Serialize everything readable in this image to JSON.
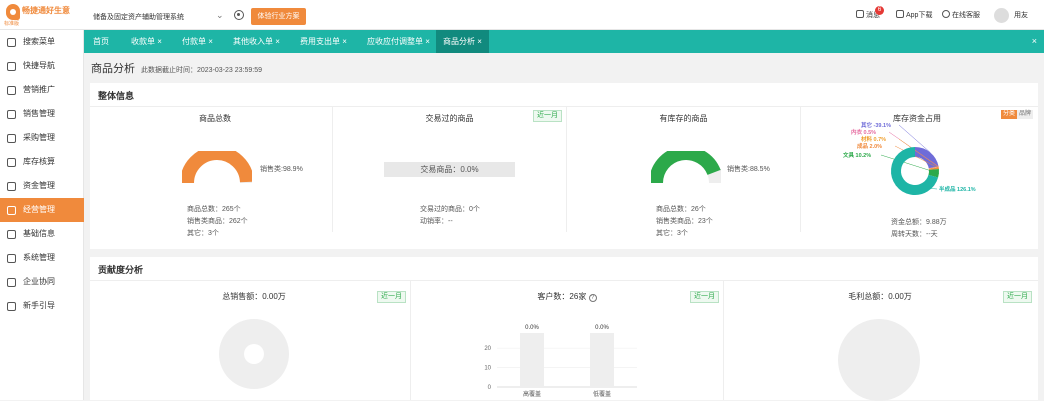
{
  "app": {
    "brand_name": "畅捷通好生意",
    "brand_edition": "标准版",
    "company": "储备及固定资产辅助管理系统",
    "try_button": "体验行业方案"
  },
  "topbar": {
    "message": "消息",
    "message_count": "6",
    "app_download": "App下载",
    "online_service": "在线客服",
    "user": "用友"
  },
  "sidebar": {
    "items": [
      {
        "label": "搜索菜单",
        "icon": "search-icon"
      },
      {
        "label": "快捷导航",
        "icon": "home-icon"
      },
      {
        "label": "营销推广",
        "icon": "calendar-icon"
      },
      {
        "label": "销售管理",
        "icon": "sales-icon"
      },
      {
        "label": "采购管理",
        "icon": "purchase-icon"
      },
      {
        "label": "库存核算",
        "icon": "warehouse-icon"
      },
      {
        "label": "资金管理",
        "icon": "fund-icon"
      },
      {
        "label": "经营管理",
        "icon": "business-icon",
        "active": true
      },
      {
        "label": "基础信息",
        "icon": "info-icon"
      },
      {
        "label": "系统管理",
        "icon": "system-icon"
      },
      {
        "label": "企业协同",
        "icon": "collab-icon"
      },
      {
        "label": "新手引导",
        "icon": "guide-icon"
      }
    ]
  },
  "tabs": [
    {
      "label": "首页",
      "close": ""
    },
    {
      "label": "收款单",
      "close": "×"
    },
    {
      "label": "付款单",
      "close": "×"
    },
    {
      "label": "其他收入单",
      "close": "×"
    },
    {
      "label": "费用支出单",
      "close": "×"
    },
    {
      "label": "应收应付调整单",
      "close": "×"
    },
    {
      "label": "商品分析",
      "close": "×",
      "active": true
    }
  ],
  "tabbar_close": "×",
  "page": {
    "title": "商品分析",
    "deadline": "此数据截止时间：2023-03-23 23:59:59"
  },
  "overview": {
    "title": "整体信息",
    "total_goods": {
      "title": "商品总数",
      "legend": "销售类:98.9%",
      "count": "商品总数：265个",
      "sales_goods": "销售类商品：262个",
      "others": "其它：3个"
    },
    "traded_goods": {
      "title": "交易过的商品",
      "tag": "近一月",
      "box_label": "交易商品：0.0%",
      "count": "交易过的商品：0个",
      "moving": "动销率：--"
    },
    "stocked_goods": {
      "title": "有库存的商品",
      "legend": "销售类:88.5%",
      "count": "商品总数：26个",
      "sales_goods": "销售类商品：23个",
      "others": "其它：3个"
    },
    "stock_funds": {
      "title": "库存资金占用",
      "toggle_a": "分类",
      "toggle_b": "品牌",
      "total": "资金总额：9.88万",
      "turnover": "周转天数：--天"
    }
  },
  "contribution": {
    "title": "贡献度分析",
    "sales": {
      "title": "总销售额：0.00万",
      "tag": "近一月"
    },
    "customers": {
      "title": "客户数：26家",
      "tag": "近一月",
      "help_icon": "?"
    },
    "profit": {
      "title": "毛利总额：0.00万",
      "tag": "近一月"
    }
  },
  "colors": {
    "accent": "#f08a3c",
    "teal": "#1eb5a6",
    "green": "#2ca94a"
  },
  "chart_data": [
    {
      "type": "pie",
      "title": "商品总数",
      "series": [
        {
          "name": "销售类",
          "values": [
            98.9,
            1.1
          ]
        }
      ],
      "style": "half-donut"
    },
    {
      "type": "pie",
      "title": "有库存的商品",
      "series": [
        {
          "name": "销售类",
          "values": [
            88.5,
            11.5
          ]
        }
      ],
      "style": "half-donut"
    },
    {
      "type": "pie",
      "title": "库存资金占用",
      "categories": [
        "其它",
        "内衣",
        "材料",
        "成品",
        "文具",
        "半成品"
      ],
      "values": [
        -39.1,
        0.5,
        0.7,
        2.0,
        10.2,
        126.1
      ],
      "labels": [
        "其它 -39.1%",
        "内衣 0.5%",
        "材料 0.7%",
        "成品 2.0%",
        "文具 10.2%",
        "半成品 126.1%"
      ],
      "style": "donut"
    },
    {
      "type": "bar",
      "title": "客户数：26家",
      "categories": [
        "高覆盖",
        "低覆盖"
      ],
      "values": [
        20,
        20
      ],
      "labels": [
        "0.0%",
        "0.0%"
      ],
      "ylim": [
        0,
        20
      ],
      "yticks": [
        "0",
        "10",
        "20"
      ]
    }
  ]
}
